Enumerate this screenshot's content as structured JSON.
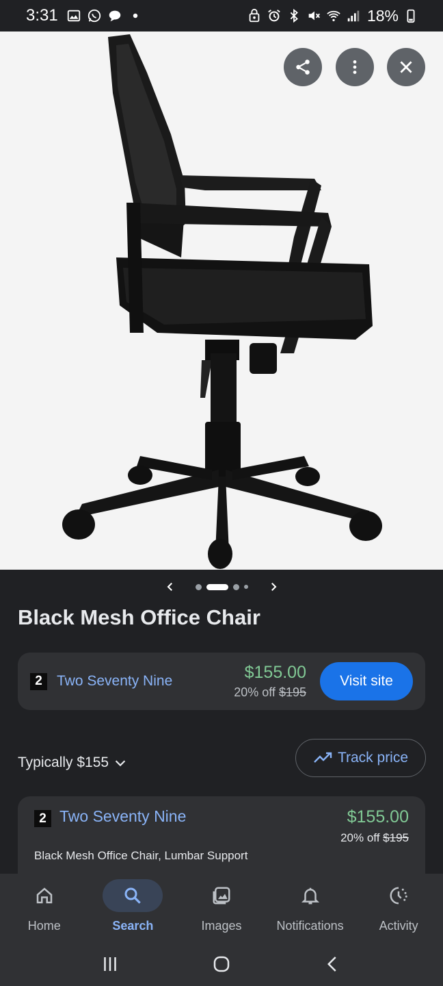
{
  "status_bar": {
    "time": "3:31",
    "battery": "18%"
  },
  "hero": {
    "image_alt": "Black mesh office chair",
    "actions": {
      "share_icon": "share-icon",
      "more_icon": "more-vert-icon",
      "close_icon": "close-icon"
    }
  },
  "carousel": {
    "prev_icon": "chevron-left-icon",
    "next_icon": "chevron-right-icon",
    "total_dots": 4,
    "active_index": 1
  },
  "product": {
    "title": "Black Mesh Office Chair"
  },
  "seller_card": {
    "badge": "2",
    "seller_name": "Two Seventy Nine",
    "price": "$155.00",
    "discount_prefix": "20% off",
    "original_price": "$195",
    "visit_label": "Visit site"
  },
  "pricing": {
    "typically_label": "Typically $155",
    "track_label": "Track price"
  },
  "listing": {
    "badge": "2",
    "seller_name": "Two Seventy Nine",
    "price": "$155.00",
    "discount_prefix": "20% off",
    "original_price": "$195",
    "description": "Black Mesh Office Chair, Lumbar Support"
  },
  "bottom_nav": {
    "items": [
      {
        "label": "Home",
        "icon": "home-icon"
      },
      {
        "label": "Search",
        "icon": "search-icon"
      },
      {
        "label": "Images",
        "icon": "images-icon"
      },
      {
        "label": "Notifications",
        "icon": "bell-icon"
      },
      {
        "label": "Activity",
        "icon": "activity-icon"
      }
    ],
    "active": "Search"
  },
  "colors": {
    "background": "#202124",
    "card": "#303134",
    "link_blue": "#8ab4f8",
    "price_green": "#81c995",
    "button_blue": "#1a73e8"
  }
}
